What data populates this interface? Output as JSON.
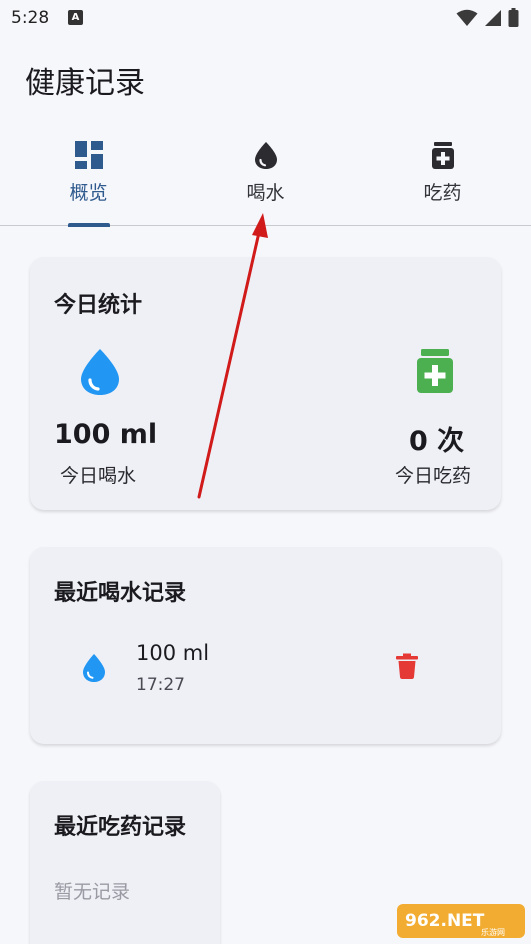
{
  "status_bar": {
    "time": "5:28",
    "notification_letter": "A"
  },
  "header": {
    "title": "健康记录"
  },
  "tabs": [
    {
      "label": "概览",
      "icon": "dashboard-icon",
      "active": true
    },
    {
      "label": "喝水",
      "icon": "water-drop-icon",
      "active": false
    },
    {
      "label": "吃药",
      "icon": "medication-icon",
      "active": false
    }
  ],
  "stats": {
    "title": "今日统计",
    "water": {
      "value": "100 ml",
      "label": "今日喝水",
      "icon": "water-drop-icon"
    },
    "medicine": {
      "value": "0 次",
      "label": "今日吃药",
      "icon": "medication-icon"
    }
  },
  "recent_water": {
    "title": "最近喝水记录",
    "records": [
      {
        "amount": "100 ml",
        "time": "17:27",
        "icon": "water-drop-icon",
        "action_icon": "delete-icon"
      }
    ]
  },
  "recent_medicine": {
    "title": "最近吃药记录",
    "empty_text": "暂无记录"
  },
  "watermark": {
    "text": "962.NET",
    "subtext": "乐游网"
  },
  "colors": {
    "primary": "#2f5a8e",
    "water": "#2196f3",
    "medicine": "#4caf50",
    "delete": "#e53935",
    "annotation_arrow": "#d11a1a"
  }
}
